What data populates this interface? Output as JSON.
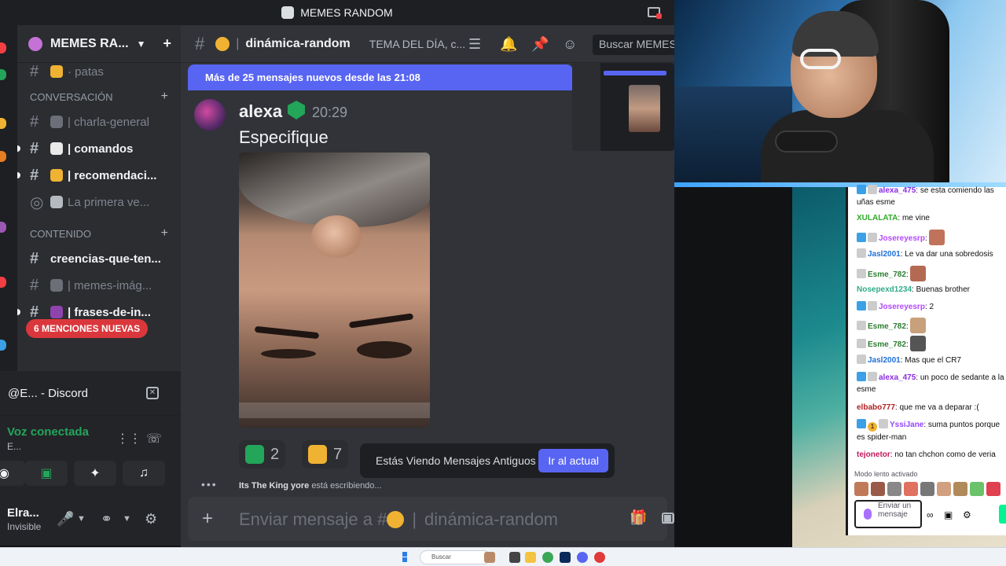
{
  "window": {
    "title": "MEMES RANDOM"
  },
  "sidebar": {
    "server_name": "MEMES RA...",
    "channels_top": [
      {
        "name": "· patas"
      }
    ],
    "category_conversacion": "CONVERSACIÓN",
    "channels_conversacion": [
      {
        "name": "| charla-general"
      },
      {
        "name": "| comandos"
      },
      {
        "name": "| recomendaci..."
      },
      {
        "name": "La primera ve..."
      }
    ],
    "category_contenido": "CONTENIDO",
    "channels_contenido": [
      {
        "name": "creencias-que-ten..."
      },
      {
        "name": "| memes-imág..."
      },
      {
        "name": "| frases-de-in..."
      }
    ],
    "mentions_pill": "6 MENCIONES NUEVAS"
  },
  "voice_panel": {
    "window_title": "@E... - Discord",
    "status": "Voz conectada",
    "sub": "E...",
    "user_name": "Elra...",
    "user_status": "Invisible"
  },
  "chat": {
    "channel_name": "dinámica-random",
    "topic": "TEMA DEL DÍA, c...",
    "search_placeholder": "Buscar MEMES",
    "new_messages_banner": "Más de 25 mensajes nuevos desde las 21:08",
    "message": {
      "author": "alexa",
      "time": "20:29",
      "text": "Especifique"
    },
    "reactions": [
      {
        "count": "2",
        "color": "#23a55a"
      },
      {
        "count": "7",
        "color": "#f0b232"
      }
    ],
    "old_messages_notice": "Estás Viendo Mensajes Antiguos",
    "jump_button": "Ir al actual",
    "typing_user": "Its The King yore",
    "typing_suffix": "está escribiendo...",
    "composer_prefix": "Enviar mensaje a #",
    "composer_channel": "dinámica-random"
  },
  "twitch_chat": {
    "messages": [
      {
        "user": "alexa_475",
        "sep": ":",
        "text": " se esta comiendo las uñas esme",
        "color": "#8a2be2"
      },
      {
        "user": "XULALATA",
        "sep": ":",
        "text": " me vine",
        "color": "#2eab27"
      },
      {
        "user": "Josereyesrp",
        "sep": ":",
        "text": "",
        "color": "#b348ff"
      },
      {
        "user": "Jasl2001",
        "sep": ":",
        "text": " Le va dar una sobredosis",
        "color": "#1e6fd9"
      },
      {
        "user": "Esme_782",
        "sep": ":",
        "text": "",
        "color": "#2e7d32"
      },
      {
        "user": "Nosepexd1234",
        "sep": ":",
        "text": " Buenas brother",
        "color": "#2eab8a"
      },
      {
        "user": "Josereyesrp",
        "sep": ":",
        "text": " 2",
        "color": "#b348ff"
      },
      {
        "user": "Esme_782",
        "sep": ":",
        "text": "",
        "color": "#2e7d32"
      },
      {
        "user": "Esme_782",
        "sep": ":",
        "text": "",
        "color": "#2e7d32"
      },
      {
        "user": "Jasl2001",
        "sep": ":",
        "text": " Mas que el CR7",
        "color": "#1e6fd9"
      },
      {
        "user": "alexa_475",
        "sep": ":",
        "text": " un poco de sedante a la esme",
        "color": "#8a2be2"
      },
      {
        "user": "elbabo777",
        "sep": ":",
        "text": " que me va a deparar :(",
        "color": "#b22222"
      },
      {
        "user": "YssiJane",
        "sep": ":",
        "text": " suma puntos porque es spider-man",
        "color": "#9146ff"
      },
      {
        "user": "tejonetor",
        "sep": ":",
        "text": " no tan chchon como de veria",
        "color": "#c2185b"
      }
    ],
    "badge_one": "1",
    "slow_mode": "Modo lento activado",
    "input_placeholder": "Enviar un mensaje"
  },
  "taskbar": {
    "search_placeholder": "Buscar"
  }
}
